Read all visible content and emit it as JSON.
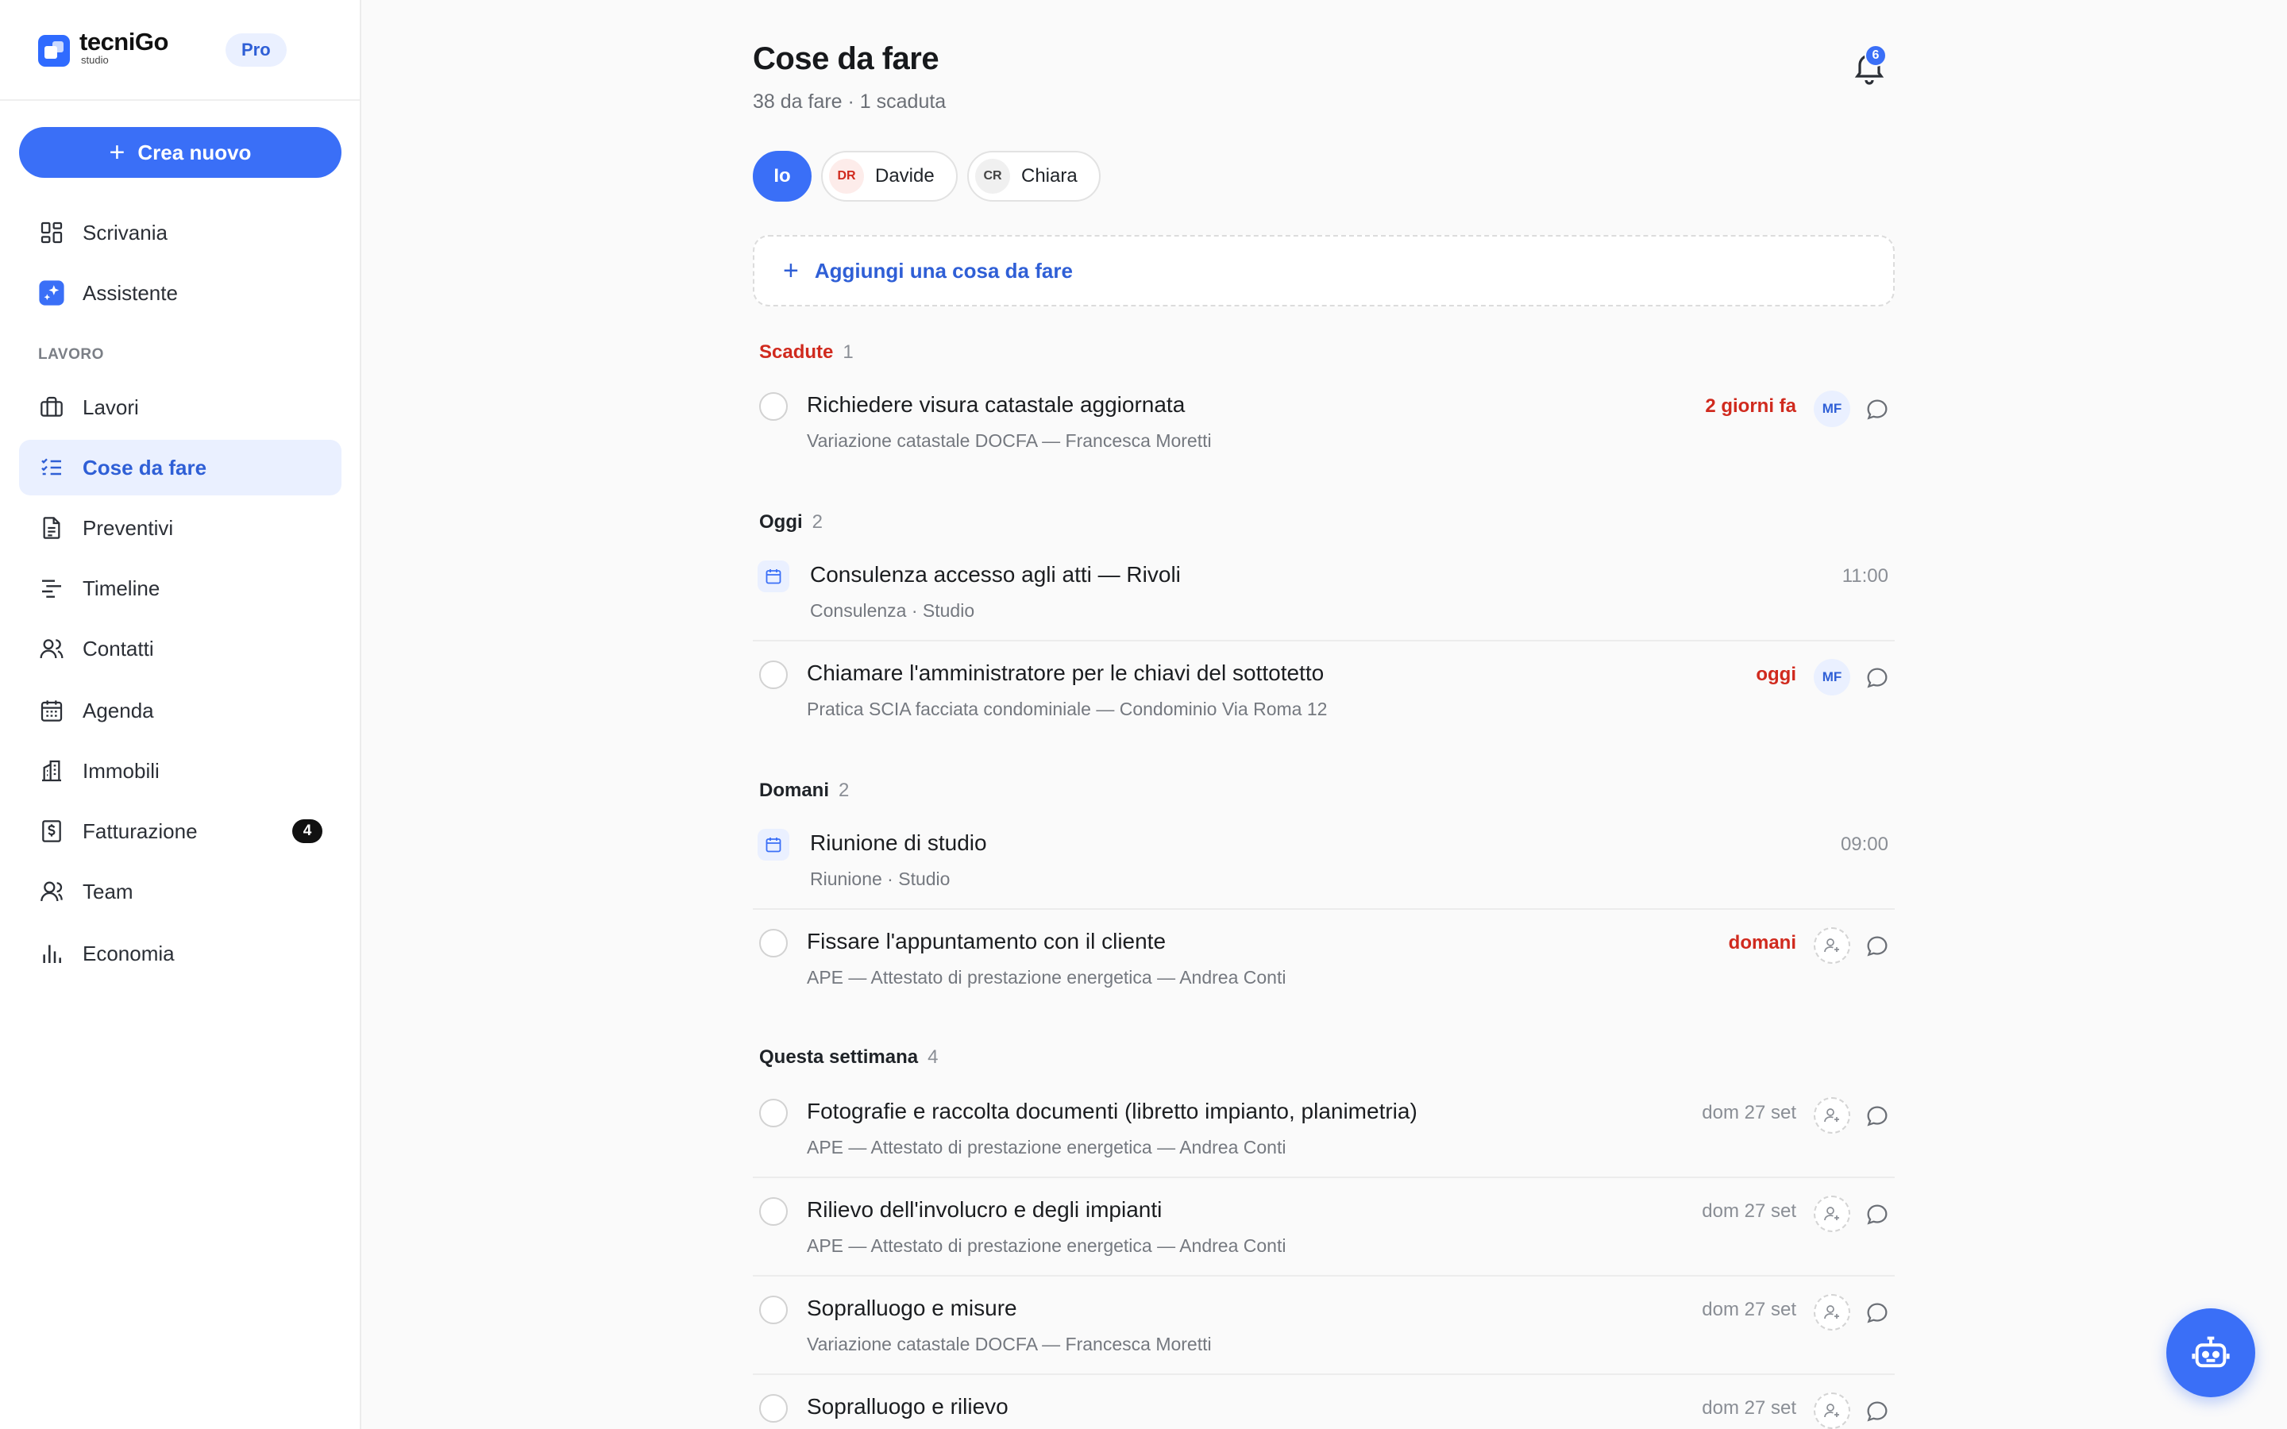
{
  "brand": {
    "name": "tecniGo",
    "sub": "studio",
    "plan": "Pro"
  },
  "sidebar": {
    "create_label": "Crea nuovo",
    "section_label": "LAVORO",
    "items": [
      {
        "label": "Scrivania",
        "icon": "dashboard-icon"
      },
      {
        "label": "Assistente",
        "icon": "sparkle-icon"
      },
      {
        "label": "Lavori",
        "icon": "briefcase-icon"
      },
      {
        "label": "Cose da fare",
        "icon": "checklist-icon",
        "active": true
      },
      {
        "label": "Preventivi",
        "icon": "document-icon"
      },
      {
        "label": "Timeline",
        "icon": "timeline-icon"
      },
      {
        "label": "Contatti",
        "icon": "users-icon"
      },
      {
        "label": "Agenda",
        "icon": "calendar-icon"
      },
      {
        "label": "Immobili",
        "icon": "building-icon"
      },
      {
        "label": "Fatturazione",
        "icon": "invoice-icon",
        "count": "4"
      },
      {
        "label": "Team",
        "icon": "team-icon"
      },
      {
        "label": "Economia",
        "icon": "chart-icon"
      }
    ]
  },
  "header": {
    "title": "Cose da fare",
    "subtitle": "38 da fare · 1 scaduta",
    "notifications": "6"
  },
  "filters": {
    "me": "Io",
    "people": [
      {
        "initials": "DR",
        "name": "Davide",
        "color": "#d02a1e",
        "bg": "#fdecea"
      },
      {
        "initials": "CR",
        "name": "Chiara",
        "color": "#444444",
        "bg": "#f0f0f0"
      }
    ]
  },
  "add_task": {
    "label": "Aggiungi una cosa da fare"
  },
  "groups": {
    "overdue": {
      "label": "Scadute",
      "count": "1"
    },
    "today": {
      "label": "Oggi",
      "count": "2"
    },
    "tomorrow": {
      "label": "Domani",
      "count": "2"
    },
    "week": {
      "label": "Questa settimana",
      "count": "4"
    }
  },
  "tasks": {
    "t1": {
      "title": "Richiedere visura catastale aggiornata",
      "sub": "Variazione catastale DOCFA — Francesca Moretti",
      "due": "2 giorni fa",
      "assignee": "MF"
    },
    "e1": {
      "title": "Consulenza accesso agli atti — Rivoli",
      "sub": "Consulenza · Studio",
      "time": "11:00"
    },
    "t2": {
      "title": "Chiamare l'amministratore per le chiavi del sottotetto",
      "sub": "Pratica SCIA facciata condominiale — Condominio Via Roma 12",
      "due": "oggi",
      "assignee": "MF"
    },
    "e2": {
      "title": "Riunione di studio",
      "sub": "Riunione · Studio",
      "time": "09:00"
    },
    "t3": {
      "title": "Fissare l'appuntamento con il cliente",
      "sub": "APE — Attestato di prestazione energetica — Andrea Conti",
      "due": "domani"
    },
    "t4": {
      "title": "Fotografie e raccolta documenti (libretto impianto, planimetria)",
      "sub": "APE — Attestato di prestazione energetica — Andrea Conti",
      "due": "dom 27 set"
    },
    "t5": {
      "title": "Rilievo dell'involucro e degli impianti",
      "sub": "APE — Attestato di prestazione energetica — Andrea Conti",
      "due": "dom 27 set"
    },
    "t6": {
      "title": "Sopralluogo e misure",
      "sub": "Variazione catastale DOCFA — Francesca Moretti",
      "due": "dom 27 set"
    },
    "t7": {
      "title": "Sopralluogo e rilievo",
      "sub": "",
      "due": "dom 27 set"
    }
  },
  "colors": {
    "accent": "#3a6ff7",
    "danger": "#d02a1e",
    "active_bg": "#eaf0ff"
  }
}
